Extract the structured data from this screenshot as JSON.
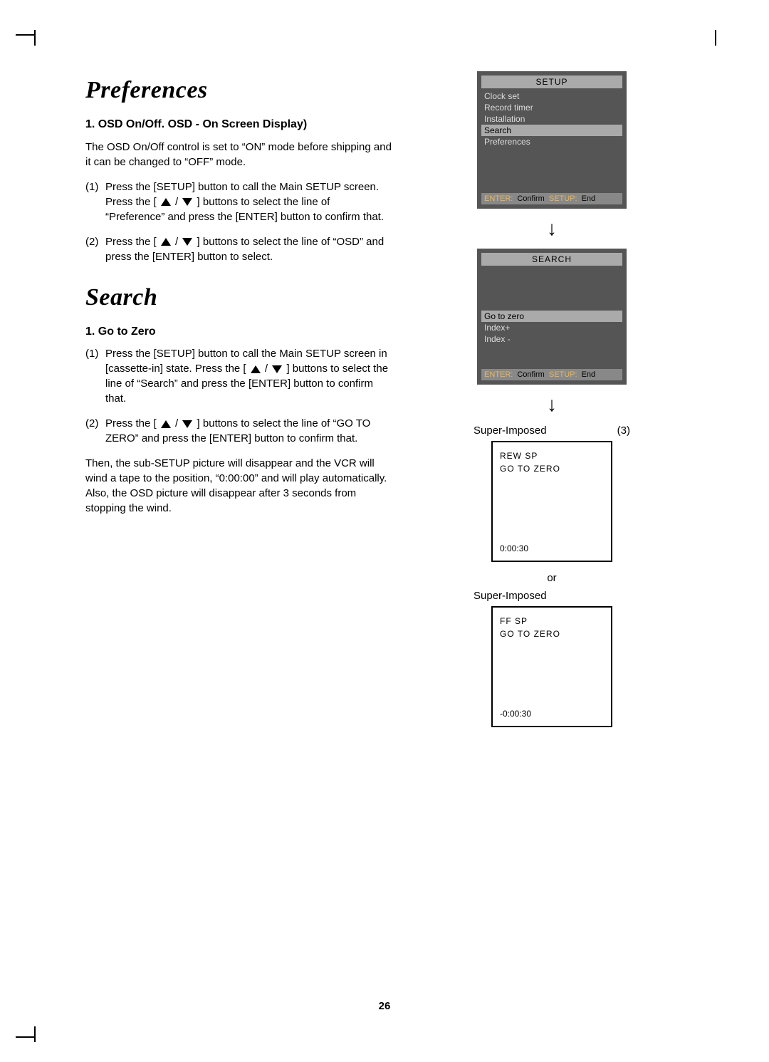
{
  "page_number": "26",
  "sections": {
    "preferences": {
      "title": "Preferences",
      "sub1_title": "1. OSD On/Off. OSD - On Screen Display)",
      "intro": "The OSD On/Off control is set to “ON” mode before shipping and it can be changed to “OFF” mode.",
      "step1_num": "(1)",
      "step1_a": "Press the [SETUP] button to call the Main SETUP screen. Press the [ ",
      "step1_b": " / ",
      "step1_c": " ] buttons to select the line of “Preference” and press the [ENTER] button to confirm that.",
      "step2_num": "(2)",
      "step2_a": "Press the [ ",
      "step2_b": " / ",
      "step2_c": " ] buttons to select the line of “OSD” and press the [ENTER] button to select."
    },
    "search": {
      "title": "Search",
      "sub1_title": "1. Go to Zero",
      "step1_num": "(1)",
      "step1_a": "Press the [SETUP] button to call the Main SETUP screen in [cassette-in] state. Press the [ ",
      "step1_b": " / ",
      "step1_c": " ] buttons to select the line of “Search” and press the [ENTER] button to confirm that.",
      "step2_num": "(2)",
      "step2_a": "Press the [ ",
      "step2_b": " / ",
      "step2_c": " ] buttons to select the line of “GO TO ZERO” and press the [ENTER] button to confirm that.",
      "outro": "Then, the sub-SETUP picture will disappear and the VCR will wind a tape to the position, “0:00:00” and will play automatically. Also, the OSD picture will disappear after 3 seconds from stopping the wind."
    }
  },
  "osd1": {
    "title": "SETUP",
    "items": [
      "Clock set",
      "Record timer",
      "Installation",
      "Search",
      "Preferences"
    ],
    "selected_index": 3,
    "footer_enter": "ENTER:",
    "footer_confirm": "Confirm",
    "footer_setup": "SETUP:",
    "footer_end": "End"
  },
  "osd2": {
    "title": "SEARCH",
    "items": [
      "Go to zero",
      "Index+",
      "Index -"
    ],
    "selected_index": 0,
    "footer_enter": "ENTER:",
    "footer_confirm": "Confirm",
    "footer_setup": "SETUP:",
    "footer_end": "End"
  },
  "si_label1": "Super-Imposed",
  "si_label1_right": "(3)",
  "si_box1": {
    "l1": "REW SP",
    "l2": "GO TO ZERO",
    "time": "0:00:30"
  },
  "or_label": "or",
  "si_label2": "Super-Imposed",
  "si_box2": {
    "l1": "FF  SP",
    "l2": "GO TO ZERO",
    "time": "-0:00:30"
  },
  "arrow": "↓"
}
